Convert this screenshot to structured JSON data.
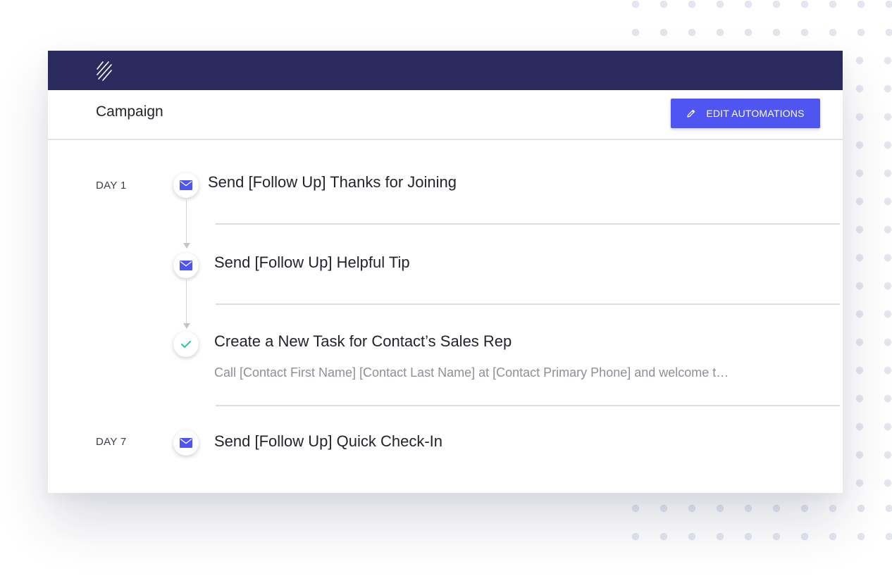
{
  "app": {
    "logo_icon": "slash-lines-logo-icon"
  },
  "header": {
    "title": "Campaign",
    "edit_button_label": "EDIT AUTOMATIONS",
    "edit_button_icon": "pencil-icon"
  },
  "colors": {
    "topbar": "#2a2a5e",
    "accent": "#4f55f1",
    "success": "#2ecf93"
  },
  "timeline": [
    {
      "day": "DAY 1",
      "steps": [
        {
          "type": "email",
          "icon": "envelope-icon",
          "title": "Send [Follow Up] Thanks for Joining"
        },
        {
          "type": "email",
          "icon": "envelope-icon",
          "title": "Send [Follow Up] Helpful Tip"
        },
        {
          "type": "task",
          "icon": "checkmark-icon",
          "title": "Create a New Task for Contact’s Sales Rep",
          "description": "Call [Contact First Name] [Contact Last Name] at [Contact Primary Phone] and welcome t…"
        }
      ]
    },
    {
      "day": "DAY 7",
      "steps": [
        {
          "type": "email",
          "icon": "envelope-icon",
          "title": "Send [Follow Up] Quick Check-In"
        }
      ]
    }
  ]
}
